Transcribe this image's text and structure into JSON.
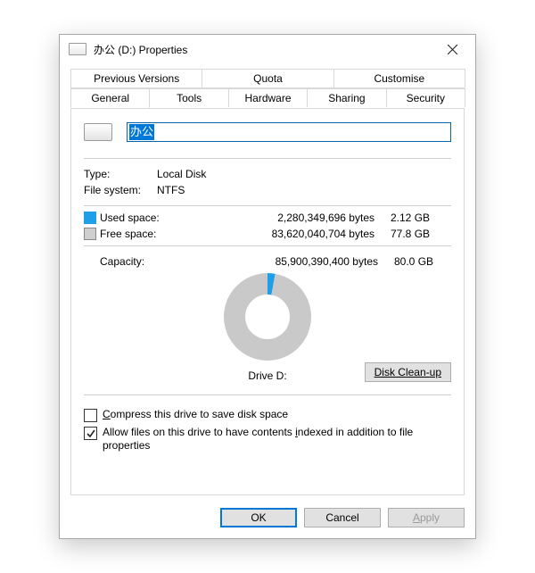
{
  "window": {
    "title": "办公 (D:) Properties"
  },
  "tabs": {
    "row1": [
      "Previous Versions",
      "Quota",
      "Customise"
    ],
    "row2": [
      "General",
      "Tools",
      "Hardware",
      "Sharing",
      "Security"
    ],
    "active": "General"
  },
  "general": {
    "name_value": "办公",
    "type_label": "Type:",
    "type_value": "Local Disk",
    "fs_label": "File system:",
    "fs_value": "NTFS",
    "used_label": "Used space:",
    "used_bytes": "2,280,349,696 bytes",
    "used_hr": "2.12 GB",
    "free_label": "Free space:",
    "free_bytes": "83,620,040,704 bytes",
    "free_hr": "77.8 GB",
    "capacity_label": "Capacity:",
    "capacity_bytes": "85,900,390,400 bytes",
    "capacity_hr": "80.0 GB",
    "drive_label": "Drive D:",
    "cleanup_btn": "Disk Clean-up",
    "colors": {
      "used": "#1e9fe8",
      "free": "#c9c9c9"
    },
    "compress_label_pre": "C",
    "compress_label_post": "ompress this drive to save disk space",
    "index_label_pre": "Allow files on this drive to have contents ",
    "index_label_u": "i",
    "index_label_post": "ndexed in addition to file properties",
    "compress_checked": false,
    "index_checked": true
  },
  "footer": {
    "ok": "OK",
    "cancel": "Cancel",
    "apply": "Apply"
  }
}
